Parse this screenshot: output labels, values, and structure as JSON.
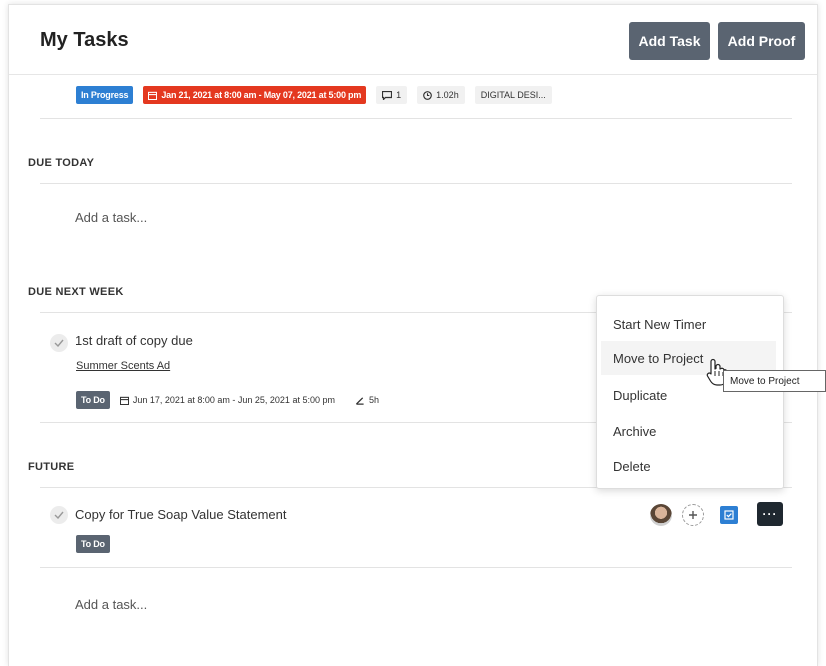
{
  "header": {
    "title": "My Tasks",
    "add_task_label": "Add Task",
    "add_proof_label": "Add Proof"
  },
  "first_task_meta": {
    "status": "In Progress",
    "date_range": "Jan 21, 2021 at 8:00 am - May 07, 2021 at 5:00 pm",
    "comments": "1",
    "time": "1.02h",
    "project_tag": "DIGITAL DESI..."
  },
  "sections": {
    "due_today": {
      "title": "DUE TODAY",
      "add_task": "Add a task..."
    },
    "due_next_week": {
      "title": "DUE NEXT WEEK",
      "task": {
        "name": "1st draft of copy due",
        "project": "Summer Scents Ad",
        "status": "To Do",
        "date_range": "Jun 17, 2021 at 8:00 am - Jun 25, 2021 at 5:00 pm",
        "estimate": "5h"
      }
    },
    "future": {
      "title": "FUTURE",
      "task": {
        "name": "Copy for True Soap Value Statement",
        "status": "To Do"
      },
      "add_task": "Add a task..."
    }
  },
  "context_menu": {
    "items": [
      "Start New Timer",
      "Move to Project",
      "Duplicate",
      "Archive",
      "Delete"
    ],
    "hovered": "Move to Project"
  },
  "tooltip": "Move to Project",
  "icons": {
    "calendar": "calendar-icon",
    "comment": "comment-icon",
    "clock": "clock-icon",
    "estimate": "estimate-icon",
    "check": "check-icon",
    "plus": "plus-icon",
    "checkbox": "checkbox-icon",
    "more": "more-icon"
  },
  "colors": {
    "in_progress": "#2d7fd3",
    "overdue": "#e4381f",
    "todo": "#5a6471",
    "button": "#5a6471",
    "more_button": "#1f2830"
  }
}
